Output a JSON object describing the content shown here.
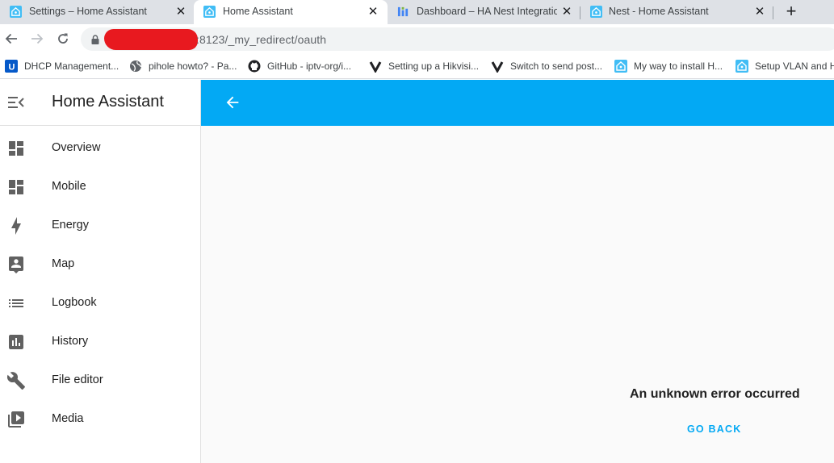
{
  "browser": {
    "tabs": [
      {
        "title": "Settings – Home Assistant",
        "icon": "home-assistant-icon",
        "active": false
      },
      {
        "title": "Home Assistant",
        "icon": "home-assistant-icon",
        "active": true
      },
      {
        "title": "Dashboard – HA Nest Integration",
        "icon": "dashboard-icon",
        "active": false
      },
      {
        "title": "Nest - Home Assistant",
        "icon": "home-assistant-icon",
        "active": false
      }
    ],
    "new_tab": "+",
    "close_glyph": "✕",
    "url": ":8123/_my_redirect/oauth",
    "bookmarks": [
      {
        "label": "DHCP Management...",
        "icon": "unifi-icon"
      },
      {
        "label": "pihole howto? - Pa...",
        "icon": "globe-icon"
      },
      {
        "label": "GitHub - iptv-org/i...",
        "icon": "github-icon"
      },
      {
        "label": "Setting up a Hikvisi...",
        "icon": "v-icon"
      },
      {
        "label": "Switch to send post...",
        "icon": "v-icon"
      },
      {
        "label": "My way to install H...",
        "icon": "home-assistant-icon"
      },
      {
        "label": "Setup VLAN and H",
        "icon": "home-assistant-icon"
      }
    ]
  },
  "app": {
    "title": "Home Assistant",
    "nav": [
      {
        "label": "Overview",
        "icon": "dashboard-icon"
      },
      {
        "label": "Mobile",
        "icon": "dashboard-icon"
      },
      {
        "label": "Energy",
        "icon": "lightning-icon"
      },
      {
        "label": "Map",
        "icon": "map-account-icon"
      },
      {
        "label": "Logbook",
        "icon": "list-icon"
      },
      {
        "label": "History",
        "icon": "chart-box-icon"
      },
      {
        "label": "File editor",
        "icon": "wrench-icon"
      },
      {
        "label": "Media",
        "icon": "play-box-icon"
      }
    ],
    "error_message": "An unknown error occurred",
    "go_back_label": "GO BACK",
    "colors": {
      "header": "#03a9f4",
      "accent": "#03a9f4",
      "icon": "#616161"
    }
  }
}
